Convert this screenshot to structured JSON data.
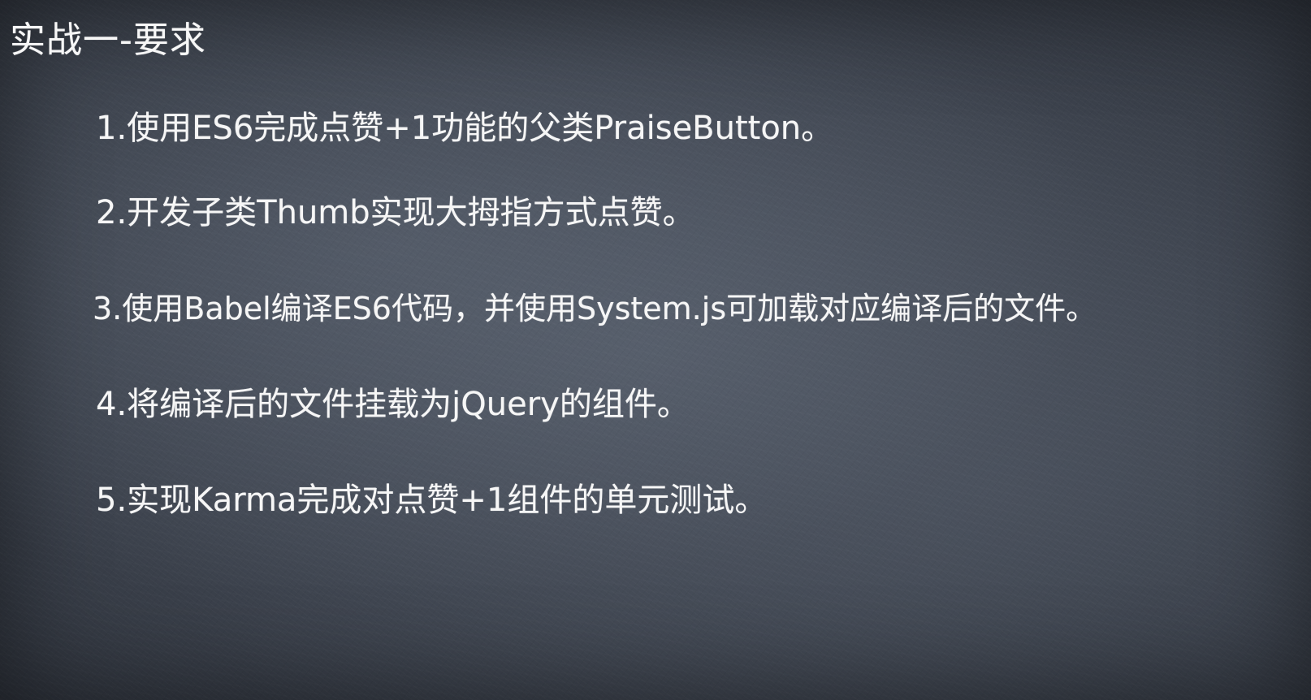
{
  "slide": {
    "title": "实战一-要求",
    "items": [
      "1.使用ES6完成点赞+1功能的父类PraiseButton。",
      "2.开发子类Thumb实现大拇指方式点赞。",
      "3.使用Babel编译ES6代码，并使用System.js可加载对应编译后的文件。",
      "4.将编译后的文件挂载为jQuery的组件。",
      "5.实现Karma完成对点赞+1组件的单元测试。"
    ]
  },
  "colors": {
    "background": "#434a55",
    "text": "#f4f4f4"
  }
}
